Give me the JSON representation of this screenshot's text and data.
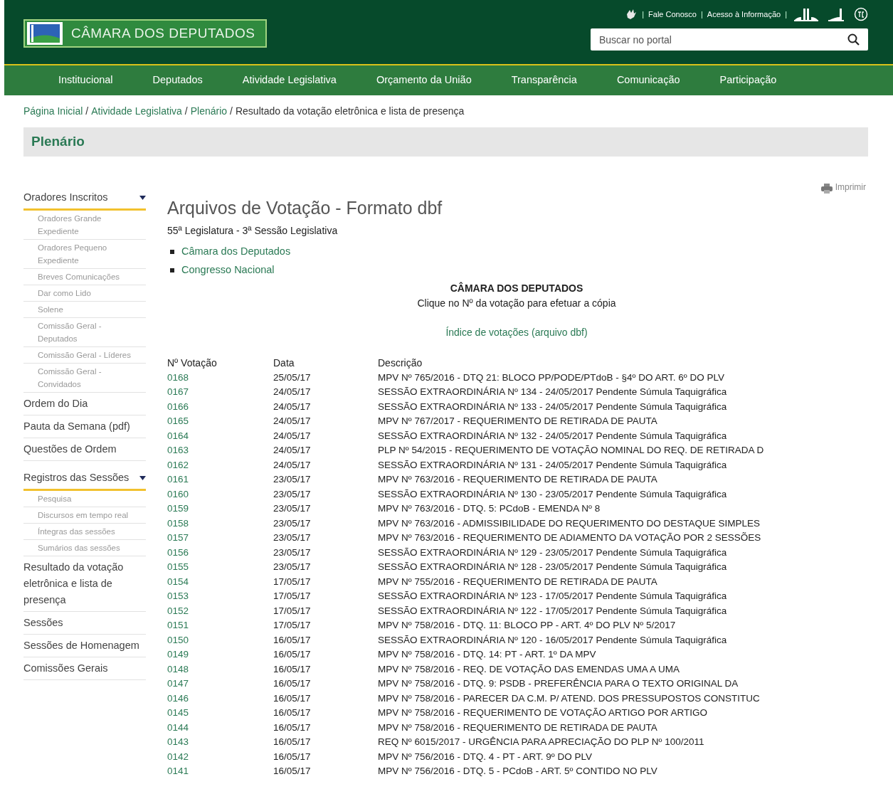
{
  "header": {
    "logo_text": "CÂMARA DOS DEPUTADOS",
    "top_links": [
      "Fale Conosco",
      "Acesso à Informação"
    ],
    "top_separators": [
      "|",
      "|",
      "|"
    ],
    "search": {
      "placeholder": "Buscar no portal"
    }
  },
  "nav": [
    "Institucional",
    "Deputados",
    "Atividade Legislativa",
    "Orçamento da União",
    "Transparência",
    "Comunicação",
    "Participação"
  ],
  "breadcrumb": {
    "links": [
      "Página Inicial",
      "Atividade Legislativa",
      "Plenário"
    ],
    "separators": [
      "/",
      "/",
      "/"
    ],
    "current": "Resultado da votação eletrônica e lista de presença"
  },
  "section_title": "Plenário",
  "sidebar": [
    {
      "label": "Oradores Inscritos",
      "expanded": true,
      "children": [
        {
          "label": "Oradores Grande Expediente"
        },
        {
          "label": "Oradores Pequeno Expediente"
        },
        {
          "label": "Breves Comunicações"
        },
        {
          "label": "Dar como Lido"
        },
        {
          "label": "Solene"
        },
        {
          "label": "Comissão Geral - Deputados"
        },
        {
          "label": "Comissão Geral - Líderes"
        },
        {
          "label": "Comissão Geral - Convidados"
        }
      ]
    },
    {
      "label": "Ordem do Dia"
    },
    {
      "label": "Pauta da Semana (pdf)"
    },
    {
      "label": "Questões de Ordem"
    },
    {
      "label": "Registros das Sessões",
      "expanded": true,
      "children": [
        {
          "label": "Pesquisa"
        },
        {
          "label": "Discursos em tempo real"
        },
        {
          "label": "Íntegras das sessões"
        },
        {
          "label": "Sumários das sessões"
        }
      ]
    },
    {
      "label": "Resultado da votação eletrônica e lista de presença"
    },
    {
      "label": "Sessões"
    },
    {
      "label": "Sessões de Homenagem"
    },
    {
      "label": "Comissões Gerais"
    }
  ],
  "print_link": "Imprimir",
  "title": "Arquivos de Votação - Formato dbf",
  "subtitle": "55ª Legislatura - 3ª Sessão Legislativa",
  "links": [
    "Câmara dos Deputados",
    "Congresso Nacional"
  ],
  "table_heading": "CÂMARA DOS DEPUTADOS",
  "instruction": "Clique no Nº da votação para efetuar a cópia",
  "index_link": "Índice de votações (arquivo dbf)",
  "table": {
    "columns": [
      "Nº Votação",
      "Data",
      "Descrição"
    ],
    "rows": [
      [
        "0168",
        "25/05/17",
        "MPV Nº 765/2016 - DTQ 21: BLOCO PP/PODE/PTdoB - §4º DO ART. 6º DO PLV"
      ],
      [
        "0167",
        "24/05/17",
        "SESSÃO EXTRAORDINÁRIA Nº 134 - 24/05/2017 Pendente Súmula Taquigráfica"
      ],
      [
        "0166",
        "24/05/17",
        "SESSÃO EXTRAORDINÁRIA Nº 133 - 24/05/2017 Pendente Súmula Taquigráfica"
      ],
      [
        "0165",
        "24/05/17",
        "MPV Nº 767/2017 - REQUERIMENTO DE RETIRADA DE PAUTA"
      ],
      [
        "0164",
        "24/05/17",
        "SESSÃO EXTRAORDINÁRIA Nº 132 - 24/05/2017 Pendente Súmula Taquigráfica"
      ],
      [
        "0163",
        "24/05/17",
        "PLP Nº 54/2015 - REQUERIMENTO DE VOTAÇÃO NOMINAL DO REQ. DE RETIRADA D"
      ],
      [
        "0162",
        "24/05/17",
        "SESSÃO EXTRAORDINÁRIA Nº 131 - 24/05/2017 Pendente Súmula Taquigráfica"
      ],
      [
        "0161",
        "23/05/17",
        "MPV Nº 763/2016 - REQUERIMENTO DE RETIRADA DE PAUTA"
      ],
      [
        "0160",
        "23/05/17",
        "SESSÃO EXTRAORDINÁRIA Nº 130 - 23/05/2017 Pendente Súmula Taquigráfica"
      ],
      [
        "0159",
        "23/05/17",
        "MPV Nº 763/2016 - DTQ. 5: PCdoB - EMENDA Nº 8"
      ],
      [
        "0158",
        "23/05/17",
        "MPV Nº 763/2016 - ADMISSIBILIDADE DO REQUERIMENTO DO DESTAQUE SIMPLES"
      ],
      [
        "0157",
        "23/05/17",
        "MPV Nº 763/2016 - REQUERIMENTO DE ADIAMENTO DA VOTAÇÃO POR 2 SESSÕES"
      ],
      [
        "0156",
        "23/05/17",
        "SESSÃO EXTRAORDINÁRIA Nº 129 - 23/05/2017 Pendente Súmula Taquigráfica"
      ],
      [
        "0155",
        "23/05/17",
        "SESSÃO EXTRAORDINÁRIA Nº 128 - 23/05/2017 Pendente Súmula Taquigráfica"
      ],
      [
        "0154",
        "17/05/17",
        "MPV Nº 755/2016 - REQUERIMENTO DE RETIRADA DE PAUTA"
      ],
      [
        "0153",
        "17/05/17",
        "SESSÃO EXTRAORDINÁRIA Nº 123 - 17/05/2017 Pendente Súmula Taquigráfica"
      ],
      [
        "0152",
        "17/05/17",
        "SESSÃO EXTRAORDINÁRIA Nº 122 - 17/05/2017 Pendente Súmula Taquigráfica"
      ],
      [
        "0151",
        "17/05/17",
        "MPV Nº 758/2016 - DTQ. 11: BLOCO PP - ART. 4º DO PLV Nº 5/2017"
      ],
      [
        "0150",
        "16/05/17",
        "SESSÃO EXTRAORDINÁRIA Nº 120 - 16/05/2017 Pendente Súmula Taquigráfica"
      ],
      [
        "0149",
        "16/05/17",
        "MPV Nº 758/2016 - DTQ. 14: PT - ART. 1º DA MPV"
      ],
      [
        "0148",
        "16/05/17",
        "MPV Nº 758/2016 - REQ. DE VOTAÇÃO DAS EMENDAS UMA A UMA"
      ],
      [
        "0147",
        "16/05/17",
        "MPV Nº 758/2016 - DTQ. 9: PSDB - PREFERÊNCIA PARA O TEXTO ORIGINAL DA"
      ],
      [
        "0146",
        "16/05/17",
        "MPV Nº 758/2016 - PARECER DA C.M. P/ ATEND. DOS PRESSUPOSTOS CONSTITUC"
      ],
      [
        "0145",
        "16/05/17",
        "MPV Nº 758/2016 - REQUERIMENTO DE VOTAÇÃO ARTIGO POR ARTIGO"
      ],
      [
        "0144",
        "16/05/17",
        "MPV Nº 758/2016 - REQUERIMENTO DE RETIRADA DE PAUTA"
      ],
      [
        "0143",
        "16/05/17",
        "REQ Nº 6015/2017 - URGÊNCIA PARA APRECIAÇÃO DO PLP Nº 100/2011"
      ],
      [
        "0142",
        "16/05/17",
        "MPV Nº 756/2016 - DTQ. 4 - PT - ART. 9º DO PLV"
      ],
      [
        "0141",
        "16/05/17",
        "MPV Nº 756/2016 - DTQ. 5 - PCdoB - ART. 5º CONTIDO NO PLV"
      ]
    ]
  }
}
